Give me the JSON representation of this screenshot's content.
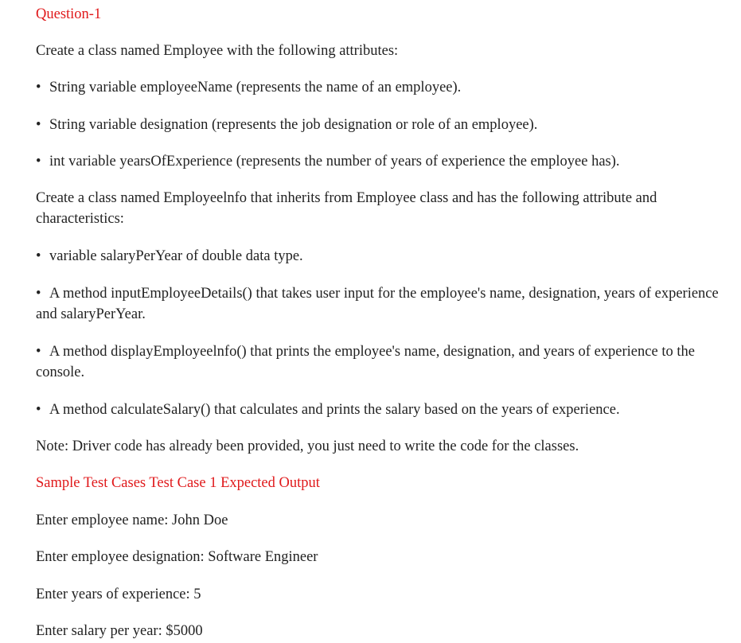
{
  "title": "Question-1",
  "intro": "Create a class named Employee with the following attributes:",
  "employee_attributes": [
    "String variable employeeName (represents the name of an employee).",
    "String variable designation (represents the job designation or role of an employee).",
    "int variable yearsOfExperience (represents the number of years of experience the employee has)."
  ],
  "info_intro": "Create a class named Employeelnfo that inherits from Employee class and has the following attribute and characteristics:",
  "info_items": [
    "variable salaryPerYear of double data type.",
    "A method inputEmployeeDetails() that takes user input for the employee's name, designation, years of experience and salaryPerYear.",
    "A method displayEmployeelnfo() that prints the employee's name, designation, and years of experience to the console.",
    "A method calculateSalary() that calculates and prints the salary based on the years of experience."
  ],
  "note": "Note: Driver code has already been provided, you just need to write the code for the classes.",
  "sample_heading": "Sample Test Cases Test Case 1 Expected Output",
  "sample_lines": [
    "Enter employee name: John Doe",
    "Enter employee designation: Software Engineer",
    "Enter years of experience: 5",
    "Enter salary per year: $5000"
  ],
  "bullet_glyph": "•",
  "colors": {
    "heading": "#e0191b",
    "text": "#222222",
    "background": "#ffffff"
  }
}
